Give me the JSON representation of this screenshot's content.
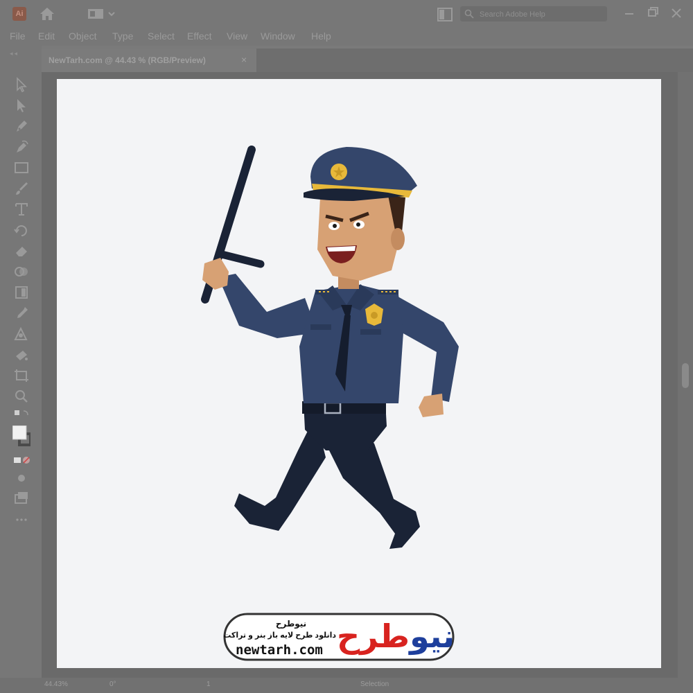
{
  "app": {
    "logo_text": "Ai"
  },
  "search": {
    "placeholder": "Search Adobe Help"
  },
  "menu": [
    {
      "label": "File"
    },
    {
      "label": "Edit"
    },
    {
      "label": "Object"
    },
    {
      "label": "Type"
    },
    {
      "label": "Select"
    },
    {
      "label": "Effect"
    },
    {
      "label": "View"
    },
    {
      "label": "Window"
    },
    {
      "label": "Help"
    }
  ],
  "document": {
    "tab_label": "NewTarh.com @ 44.43 % (RGB/Preview)",
    "close_symbol": "×"
  },
  "status": {
    "zoom": "44.43%",
    "rotation": "0°",
    "artboard": "1",
    "tool": "Selection"
  },
  "watermark": {
    "title": "نیوطرح",
    "subtitle": "دانلود طرح لایه باز بنر و تراکت",
    "url": "newtarh.com",
    "logo_red": "طرح",
    "logo_blue": "نیو"
  },
  "colors": {
    "uniform": "#34466b",
    "trousers": "#1a2336",
    "badge": "#e8b93a",
    "skin": "#d7a174"
  }
}
